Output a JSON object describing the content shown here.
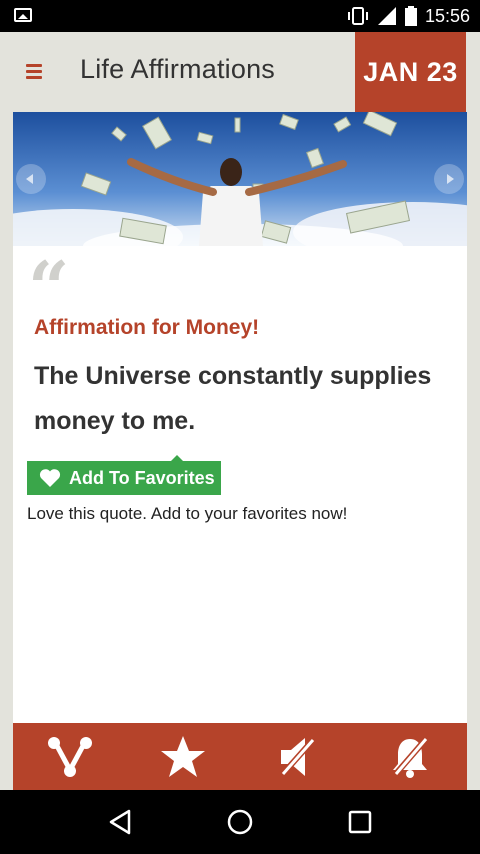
{
  "status_bar": {
    "time": "15:56",
    "icons": [
      "gallery-icon",
      "vibrate-icon",
      "signal-icon",
      "battery-icon"
    ]
  },
  "header": {
    "title": "Life Affirmations",
    "date": "JAN 23",
    "menu_icon": "hamburger-menu-icon"
  },
  "colors": {
    "accent": "#b5432a",
    "favorite_green": "#3aa64a",
    "background": "#e3e3dc",
    "text_dark": "#333333"
  },
  "affirmation": {
    "category": "Affirmation for Money!",
    "text": "The Universe constantly supplies money to me."
  },
  "favorites": {
    "button_label": "Add To Favorites",
    "caption": "Love this quote. Add to your favorites now!"
  },
  "bottom_bar": {
    "buttons": [
      "share-icon",
      "star-icon",
      "sound-off-icon",
      "notifications-off-icon"
    ]
  },
  "nav_bar": {
    "buttons": [
      "back-icon",
      "home-icon",
      "recents-icon"
    ]
  }
}
